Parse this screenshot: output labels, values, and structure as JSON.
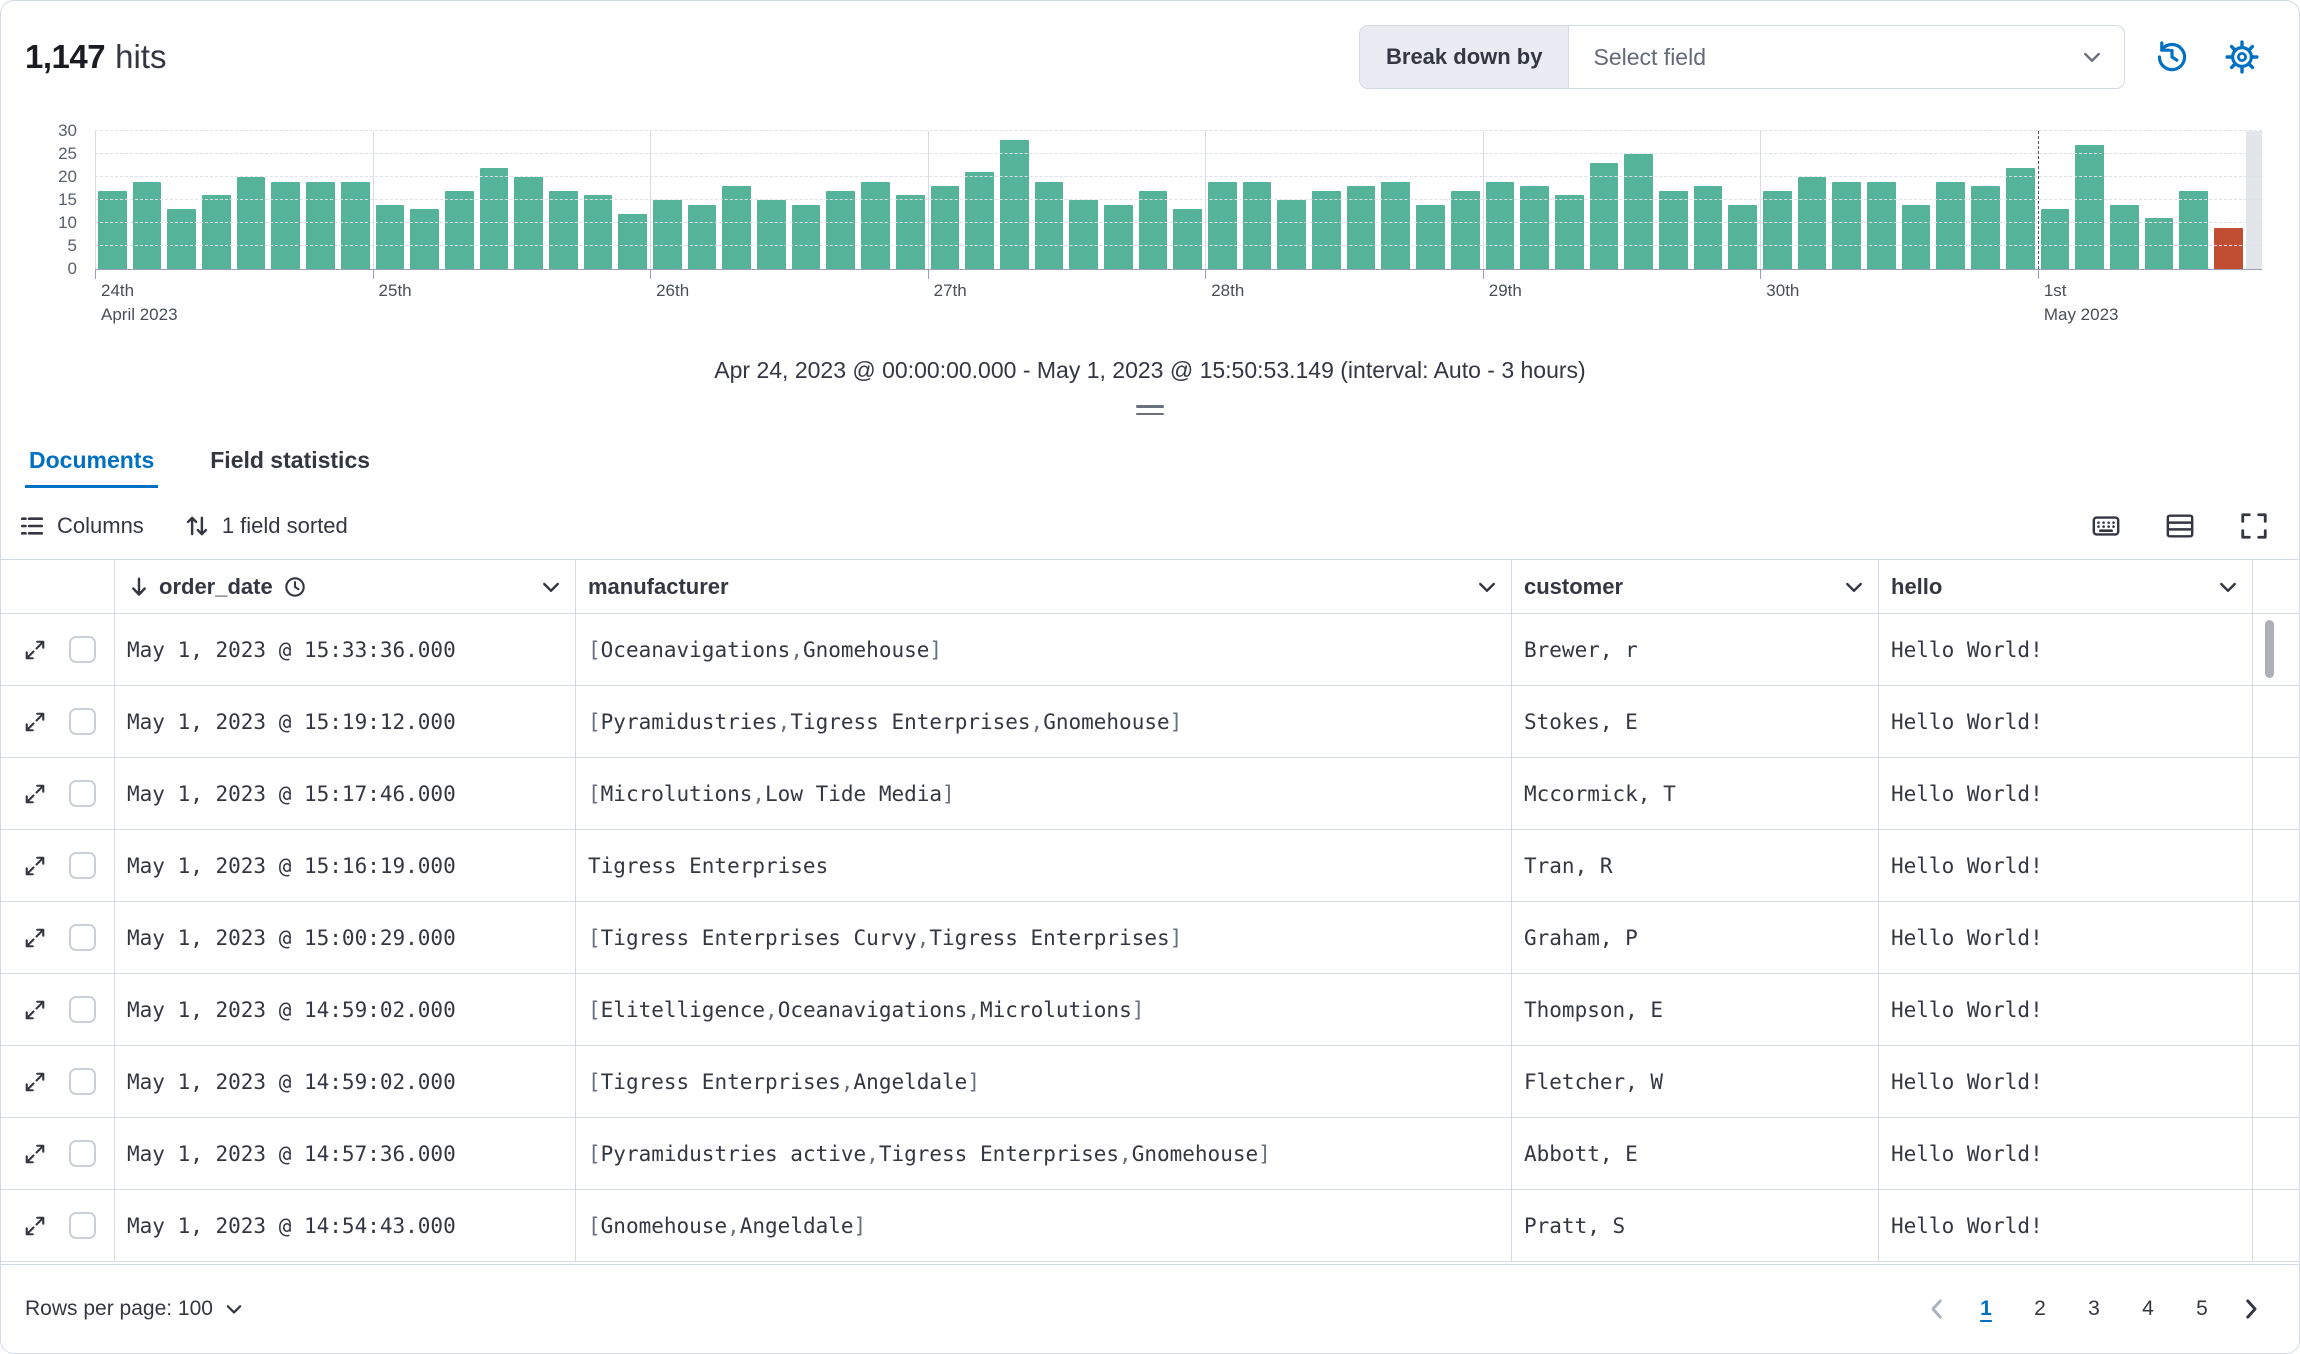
{
  "header": {
    "hits_value": "1,147",
    "hits_label": "hits",
    "breakdown": {
      "label": "Break down by",
      "placeholder": "Select field"
    }
  },
  "chart_data": {
    "type": "bar",
    "title": "",
    "xlabel": "",
    "ylabel": "",
    "ylim": [
      0,
      30
    ],
    "y_ticks": [
      0,
      5,
      10,
      15,
      20,
      25,
      30
    ],
    "interval": "Auto - 3 hours",
    "bars_per_day": 8,
    "values": [
      17,
      19,
      13,
      16,
      20,
      19,
      19,
      19,
      14,
      13,
      17,
      22,
      20,
      17,
      16,
      12,
      15,
      14,
      18,
      15,
      14,
      17,
      19,
      16,
      18,
      21,
      28,
      19,
      15,
      14,
      17,
      13,
      19,
      19,
      15,
      17,
      18,
      19,
      14,
      17,
      19,
      18,
      16,
      23,
      25,
      17,
      18,
      14,
      17,
      20,
      19,
      19,
      14,
      19,
      18,
      22,
      13,
      27,
      14,
      11,
      17,
      9
    ],
    "partial_last_bar": true,
    "bar_color": "#54B399",
    "partial_bar_color": "#C14E32",
    "day_labels": [
      {
        "label": "24th",
        "sub": "April 2023"
      },
      {
        "label": "25th"
      },
      {
        "label": "26th"
      },
      {
        "label": "27th"
      },
      {
        "label": "28th"
      },
      {
        "label": "29th"
      },
      {
        "label": "30th"
      },
      {
        "label": "1st",
        "sub": "May 2023",
        "dashed": true
      }
    ],
    "caption": "Apr 24, 2023 @ 00:00:00.000 - May 1, 2023 @ 15:50:53.149 (interval: Auto - 3 hours)"
  },
  "tabs": [
    {
      "label": "Documents",
      "active": true
    },
    {
      "label": "Field statistics",
      "active": false
    }
  ],
  "toolbar": {
    "columns_label": "Columns",
    "sorted_label": "1 field sorted"
  },
  "table": {
    "columns": [
      {
        "name": "order_date",
        "sorted": "desc",
        "type": "date"
      },
      {
        "name": "manufacturer"
      },
      {
        "name": "customer"
      },
      {
        "name": "hello"
      }
    ],
    "rows": [
      {
        "order_date": "May 1, 2023 @ 15:33:36.000",
        "manufacturer": [
          "Oceanavigations",
          "Gnomehouse"
        ],
        "customer": "Brewer, r",
        "hello": "Hello World!"
      },
      {
        "order_date": "May 1, 2023 @ 15:19:12.000",
        "manufacturer": [
          "Pyramidustries",
          "Tigress Enterprises",
          "Gnomehouse"
        ],
        "customer": "Stokes, E",
        "hello": "Hello World!"
      },
      {
        "order_date": "May 1, 2023 @ 15:17:46.000",
        "manufacturer": [
          "Microlutions",
          "Low Tide Media"
        ],
        "customer": "Mccormick, T",
        "hello": "Hello World!"
      },
      {
        "order_date": "May 1, 2023 @ 15:16:19.000",
        "manufacturer": "Tigress Enterprises",
        "customer": "Tran, R",
        "hello": "Hello World!"
      },
      {
        "order_date": "May 1, 2023 @ 15:00:29.000",
        "manufacturer": [
          "Tigress Enterprises Curvy",
          "Tigress Enterprises"
        ],
        "customer": "Graham, P",
        "hello": "Hello World!"
      },
      {
        "order_date": "May 1, 2023 @ 14:59:02.000",
        "manufacturer": [
          "Elitelligence",
          "Oceanavigations",
          "Microlutions"
        ],
        "customer": "Thompson, E",
        "hello": "Hello World!"
      },
      {
        "order_date": "May 1, 2023 @ 14:59:02.000",
        "manufacturer": [
          "Tigress Enterprises",
          "Angeldale"
        ],
        "customer": "Fletcher, W",
        "hello": "Hello World!"
      },
      {
        "order_date": "May 1, 2023 @ 14:57:36.000",
        "manufacturer": [
          "Pyramidustries active",
          "Tigress Enterprises",
          "Gnomehouse"
        ],
        "customer": "Abbott, E",
        "hello": "Hello World!"
      },
      {
        "order_date": "May 1, 2023 @ 14:54:43.000",
        "manufacturer": [
          "Gnomehouse",
          "Angeldale"
        ],
        "customer": "Pratt, S",
        "hello": "Hello World!"
      }
    ]
  },
  "footer": {
    "rows_per_page": "Rows per page: 100",
    "pages": [
      "1",
      "2",
      "3",
      "4",
      "5"
    ],
    "active_page": "1"
  },
  "icons": {
    "history": "clock-with-circular-arrow",
    "gear": "settings-gear",
    "columns": "list-lines",
    "sort": "up-down-arrows",
    "keyboard": "keyboard",
    "display_options": "table-rows",
    "fullscreen": "corner-brackets",
    "expand_row": "diagonal-expand-arrows",
    "sort_desc": "arrow-down",
    "date_field": "clock",
    "chevron_down": "chevron-down"
  },
  "colors": {
    "accent": "#0071C2",
    "bar": "#54B399",
    "partial_bar": "#C14E32",
    "border": "#D3DAE6",
    "grey_text": "#69707D"
  }
}
